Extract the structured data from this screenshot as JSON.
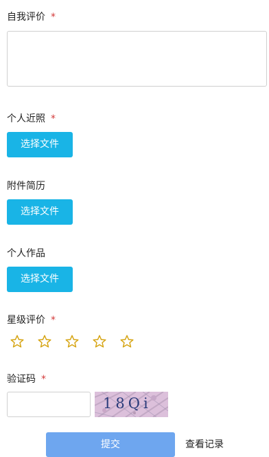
{
  "form": {
    "self_evaluation": {
      "label": "自我评价",
      "required_mark": "*",
      "value": ""
    },
    "photo": {
      "label": "个人近照",
      "required_mark": "*",
      "button_label": "选择文件"
    },
    "resume": {
      "label": "附件简历",
      "button_label": "选择文件"
    },
    "works": {
      "label": "个人作品",
      "button_label": "选择文件"
    },
    "rating": {
      "label": "星级评价",
      "required_mark": "*",
      "star_icon": "star-outline-icon",
      "max_stars": 5,
      "selected": 0
    },
    "captcha": {
      "label": "验证码",
      "required_mark": "*",
      "input_value": "",
      "image_text": "18Qi"
    },
    "submit_label": "提交",
    "history_label": "查看记录"
  },
  "colors": {
    "required": "#d33a3a",
    "file_button": "#19b4e6",
    "submit_button": "#6ea6ef",
    "star_stroke": "#d6a412",
    "captcha_bg": "#d7b6d5",
    "captcha_text": "#2a3b7a"
  }
}
